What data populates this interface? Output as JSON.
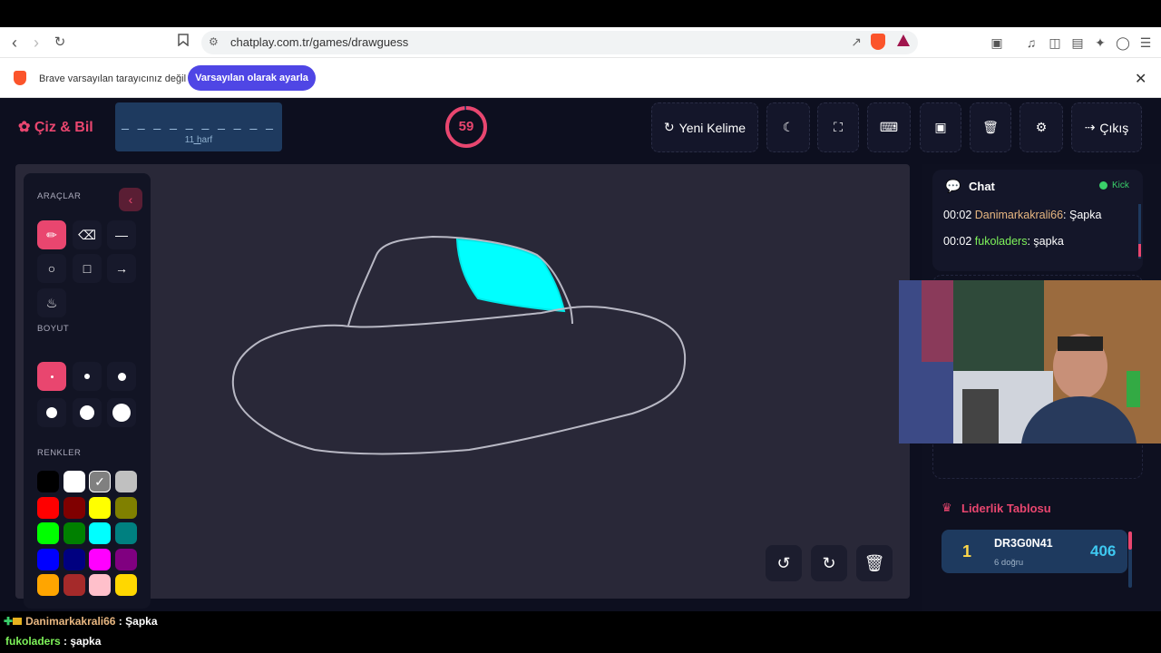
{
  "browser": {
    "url": "chatplay.com.tr/games/drawguess",
    "notice": "Brave varsayılan tarayıcınız değil",
    "set_default_label": "Varsayılan olarak ayarla"
  },
  "app": {
    "logo": "Çiz & Bil",
    "word_dashes": "_ _ _ _ _ _ _ _ _ _ _",
    "letter_count": "11 harf",
    "timer": "59",
    "buttons": {
      "new_word": "Yeni Kelime",
      "exit": "Çıkış"
    },
    "colors": {
      "accent": "#e9466f",
      "bg": "#0d0f1f",
      "canvas": "#292838",
      "drawing_fill": "#00ffff"
    }
  },
  "tools": {
    "section_tools": "ARAÇLAR",
    "section_size": "BOYUT",
    "section_colors": "RENKLER",
    "palette": [
      "#000000",
      "#ffffff",
      "#808080",
      "#c0c0c0",
      "#ff0000",
      "#800000",
      "#ffff00",
      "#808000",
      "#00ff00",
      "#008000",
      "#00ffff",
      "#008080",
      "#0000ff",
      "#000080",
      "#ff00ff",
      "#800080",
      "#ffa500",
      "#a52a2a",
      "#ffc0cb",
      "#ffd700"
    ]
  },
  "chat": {
    "title": "Chat",
    "status": "Kick",
    "messages": [
      {
        "time": "00:02",
        "user": "Danimarkakrali66",
        "text": "Şapka",
        "color": "#e7b680"
      },
      {
        "time": "00:02",
        "user": "fukoladers",
        "text": "şapka",
        "color": "#7ef25a"
      }
    ]
  },
  "leaderboard": {
    "title": "Liderlik Tablosu",
    "entries": [
      {
        "rank": "1",
        "name": "DR3G0N41",
        "sub": "6 doğru",
        "score": "406"
      }
    ]
  },
  "stream_chat": [
    {
      "user": "Danimarkakrali66",
      "sep": " : ",
      "text": "Şapka"
    },
    {
      "user": "fukoladers",
      "sep": " : ",
      "text": "şapka"
    }
  ]
}
